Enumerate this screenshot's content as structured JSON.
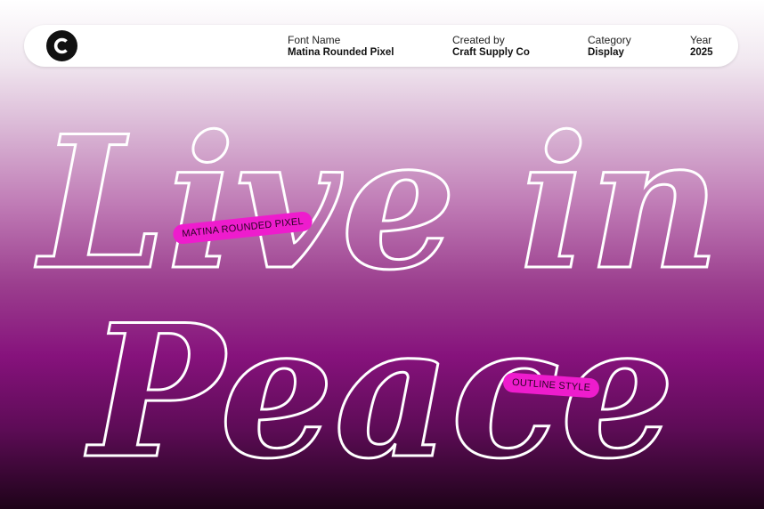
{
  "header": {
    "font_name_label": "Font Name",
    "font_name_value": "Matina Rounded Pixel",
    "created_by_label": "Created by",
    "created_by_value": "Craft Supply Co",
    "category_label": "Category",
    "category_value": "Display",
    "year_label": "Year",
    "year_value": "2025"
  },
  "headline": {
    "line1": "Live in",
    "line2": "Peace"
  },
  "tags": {
    "font_tag": "MATINA ROUNDED PIXEL",
    "style_tag": "OUTLINE STYLE"
  },
  "colors": {
    "tag_pink": "#ee1ccd",
    "background_top": "#ffffff",
    "background_mid": "#86127c",
    "background_bottom": "#1e0319",
    "text_outline": "#ffffff"
  },
  "icons": {
    "logo": "c-logo-icon"
  }
}
